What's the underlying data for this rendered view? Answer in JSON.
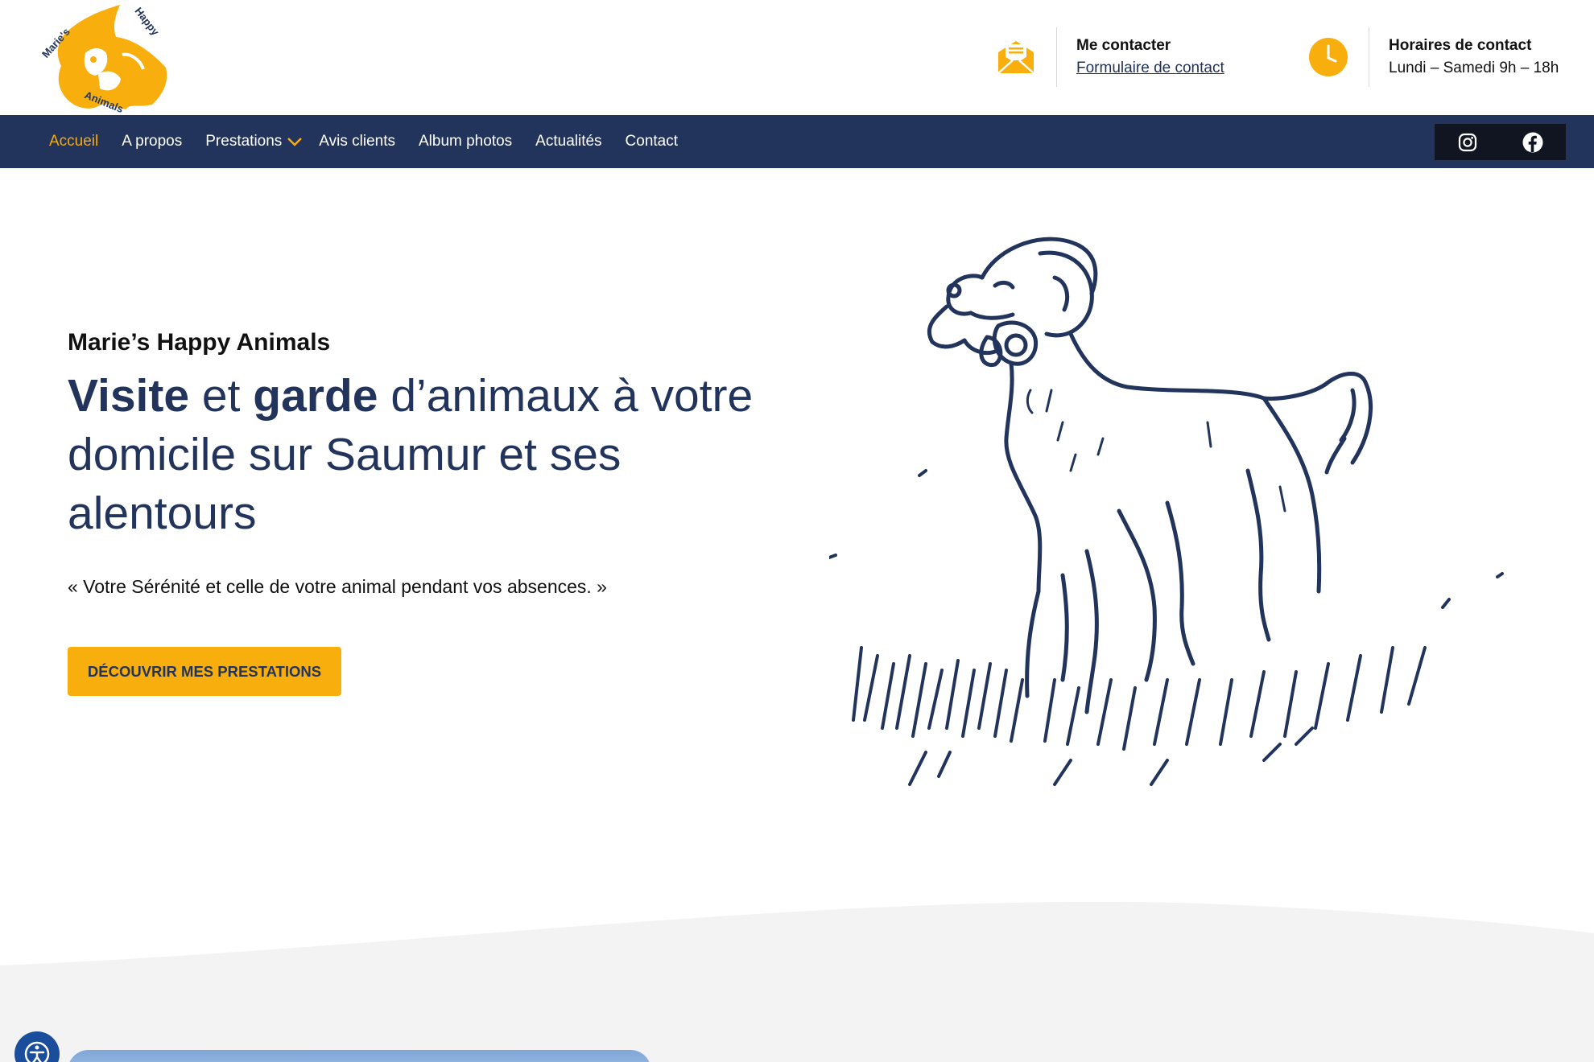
{
  "header": {
    "logo_text": [
      "Marie's",
      "Happy",
      "Animals"
    ],
    "contact": {
      "title": "Me contacter",
      "link": "Formulaire de contact"
    },
    "hours": {
      "title": "Horaires de contact",
      "value": "Lundi – Samedi 9h – 18h"
    }
  },
  "nav": {
    "items": [
      "Accueil",
      "A propos",
      "Prestations",
      "Avis clients",
      "Album photos",
      "Actualités",
      "Contact"
    ],
    "active": "Accueil",
    "social": [
      "instagram-icon",
      "facebook-icon"
    ]
  },
  "hero": {
    "subtitle": "Marie’s Happy Animals",
    "title_parts": {
      "w1": "Visite",
      "w2": " et ",
      "w3": "garde",
      "w4": " d’animaux à votre domicile sur Saumur et ses alentours"
    },
    "quote": "« Votre Sérénité et celle de votre animal pendant vos absences. »",
    "cta": "DÉCOUVRIR MES PRESTATIONS"
  },
  "colors": {
    "navy": "#22345c",
    "accent": "#f8ae0d",
    "band": "#f3f3f3"
  }
}
